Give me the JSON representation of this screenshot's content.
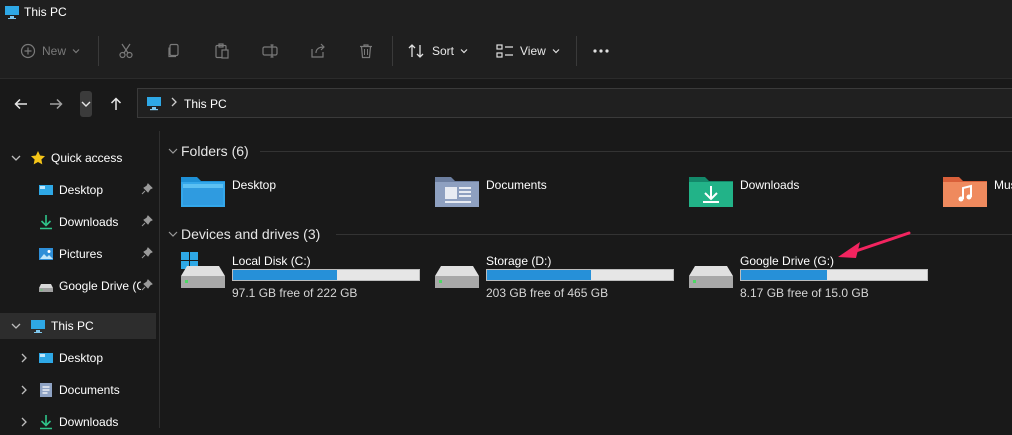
{
  "window": {
    "title": "This PC"
  },
  "toolbar": {
    "new_label": "New",
    "sort_label": "Sort",
    "view_label": "View"
  },
  "address": {
    "path": "This PC"
  },
  "sidebar": {
    "items": [
      {
        "label": "Quick access",
        "icon": "star-icon"
      },
      {
        "label": "Desktop",
        "icon": "desktop-icon",
        "pinned": true
      },
      {
        "label": "Downloads",
        "icon": "download-icon",
        "pinned": true
      },
      {
        "label": "Pictures",
        "icon": "pictures-icon",
        "pinned": true
      },
      {
        "label": "Google Drive (G:)",
        "icon": "drive-icon",
        "pinned": true
      },
      {
        "label": "This PC",
        "icon": "pc-icon",
        "selected": true
      },
      {
        "label": "Desktop",
        "icon": "desktop-icon"
      },
      {
        "label": "Documents",
        "icon": "documents-icon"
      },
      {
        "label": "Downloads",
        "icon": "download-icon"
      }
    ]
  },
  "main": {
    "folders_header": "Folders (6)",
    "folders": [
      {
        "label": "Desktop",
        "color": "#1e90d6"
      },
      {
        "label": "Documents",
        "color": "#8294b4"
      },
      {
        "label": "Downloads",
        "color": "#1faa80"
      },
      {
        "label": "Music",
        "color": "#e8794a"
      }
    ],
    "drives_header": "Devices and drives (3)",
    "drives": [
      {
        "name": "Local Disk (C:)",
        "free_text": "97.1 GB free of 222 GB",
        "used_fraction": 0.56
      },
      {
        "name": "Storage (D:)",
        "free_text": "203 GB free of 465 GB",
        "used_fraction": 0.56
      },
      {
        "name": "Google Drive (G:)",
        "free_text": "8.17 GB free of 15.0 GB",
        "used_fraction": 0.46
      }
    ]
  },
  "colors": {
    "accent": "#2690d8",
    "annotation_arrow": "#f2245f"
  }
}
